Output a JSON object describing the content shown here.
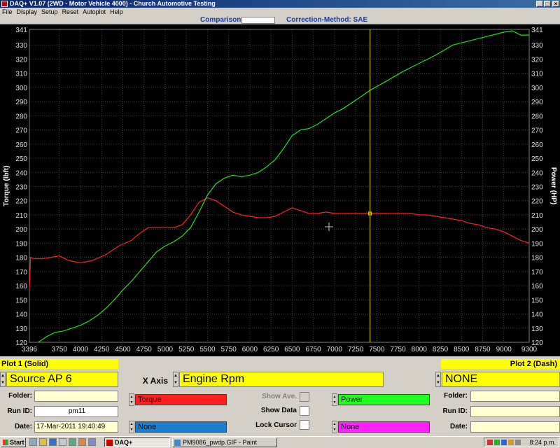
{
  "window": {
    "title": "DAQ+ V1.07 (2WD - Motor Vehicle 4000) - Church Automotive Testing",
    "controls": {
      "minimize": "_",
      "maximize": "□",
      "close": "×"
    }
  },
  "menu": [
    "File",
    "Display",
    "Setup",
    "Reset",
    "Autoplot",
    "Help"
  ],
  "infobar": {
    "comparison_label": "Comparison:",
    "comparison_value": "",
    "correction_label": "Correction-Method: SAE"
  },
  "chart_data": {
    "type": "line",
    "x_ticks": [
      "3396",
      "3750",
      "4000",
      "4250",
      "4500",
      "4750",
      "5000",
      "5250",
      "5500",
      "5750",
      "6000",
      "6250",
      "6500",
      "6750",
      "7000",
      "7250",
      "7500",
      "7750",
      "8000",
      "8250",
      "8500",
      "8750",
      "9000",
      "9300"
    ],
    "xlim": [
      3396,
      9300
    ],
    "ylabel_left": "Torque (lbft)",
    "ylabel_right": "Power (HP)",
    "y_ticks": [
      341,
      330,
      320,
      310,
      300,
      290,
      280,
      270,
      260,
      250,
      240,
      230,
      220,
      210,
      200,
      190,
      180,
      170,
      160,
      150,
      140,
      130,
      120
    ],
    "ylim": [
      120,
      341
    ],
    "grid": true,
    "cursor_x": 7420,
    "series": [
      {
        "name": "Torque",
        "color": "#ff2020",
        "x": [
          3396,
          3410,
          3450,
          3550,
          3650,
          3750,
          3850,
          4000,
          4150,
          4300,
          4450,
          4600,
          4700,
          4800,
          4900,
          5000,
          5100,
          5200,
          5300,
          5400,
          5500,
          5600,
          5700,
          5800,
          5900,
          6000,
          6100,
          6200,
          6300,
          6400,
          6500,
          6600,
          6700,
          6800,
          6900,
          7000,
          7100,
          7200,
          7300,
          7420,
          7600,
          7750,
          7900,
          8000,
          8100,
          8200,
          8300,
          8400,
          8500,
          8600,
          8700,
          8800,
          8900,
          9000,
          9100,
          9200,
          9300
        ],
        "values": [
          158,
          180,
          179,
          179,
          180,
          181,
          178,
          176,
          178,
          182,
          188,
          192,
          197,
          201,
          201,
          201,
          201,
          203,
          210,
          219,
          222,
          220,
          216,
          212,
          210,
          209,
          208,
          208,
          209,
          212,
          215,
          213,
          211,
          211,
          212,
          211,
          211,
          211,
          211,
          211,
          211,
          211,
          211,
          210,
          210,
          209,
          208,
          207,
          206,
          204,
          203,
          201,
          200,
          198,
          195,
          192,
          190
        ]
      },
      {
        "name": "Power",
        "color": "#20e020",
        "x": [
          3500,
          3600,
          3700,
          3800,
          3900,
          4000,
          4100,
          4200,
          4300,
          4400,
          4500,
          4600,
          4700,
          4800,
          4900,
          5000,
          5100,
          5200,
          5300,
          5400,
          5500,
          5600,
          5700,
          5800,
          5900,
          6000,
          6100,
          6200,
          6300,
          6400,
          6500,
          6600,
          6700,
          6800,
          6900,
          7000,
          7100,
          7200,
          7300,
          7420,
          7600,
          7800,
          8000,
          8200,
          8400,
          8600,
          8800,
          9000,
          9100,
          9200,
          9300
        ],
        "values": [
          120,
          124,
          127,
          128,
          130,
          132,
          135,
          139,
          144,
          150,
          157,
          163,
          170,
          177,
          184,
          188,
          191,
          195,
          201,
          212,
          224,
          232,
          236,
          238,
          237,
          238,
          240,
          244,
          249,
          257,
          266,
          270,
          271,
          274,
          278,
          282,
          285,
          289,
          293,
          298,
          304,
          311,
          317,
          323,
          330,
          333,
          336,
          339,
          340,
          337,
          337
        ]
      }
    ]
  },
  "plot1": {
    "header": "Plot 1 (Solid)",
    "source": "Source AP 6",
    "folder_label": "Folder:",
    "folder_value": "",
    "run_id_label": "Run ID:",
    "run_id_value": "pm11",
    "date_label": "Date:",
    "date_value": "17-Mar-2011 19:40:49",
    "channel1": "Torque",
    "channel2": "None"
  },
  "xaxis": {
    "label": "X Axis",
    "value": "Engine Rpm"
  },
  "options": {
    "show_ave": "Show Ave.",
    "show_data": "Show Data",
    "lock_cursor": "Lock Cursor"
  },
  "channels_right": {
    "channel1": "Power",
    "channel2": "None"
  },
  "plot2": {
    "header": "Plot 2 (Dash)",
    "source": "NONE",
    "folder_label": "Folder:",
    "run_id_label": "Run ID:",
    "date_label": "Date:"
  },
  "colors": {
    "torque": "#ff2020",
    "power": "#20e020",
    "channel_red": "#ff2020",
    "channel_blue": "#1a7fcf",
    "channel_green": "#20ff20",
    "channel_magenta": "#ff20ff",
    "highlight": "#ffff00",
    "cursor": "#e0e000"
  },
  "taskbar": {
    "start": "Start",
    "tasks": [
      "DAQ+",
      "PM9086_pwdp.GIF - Paint"
    ],
    "clock": "8:24 p.m."
  }
}
